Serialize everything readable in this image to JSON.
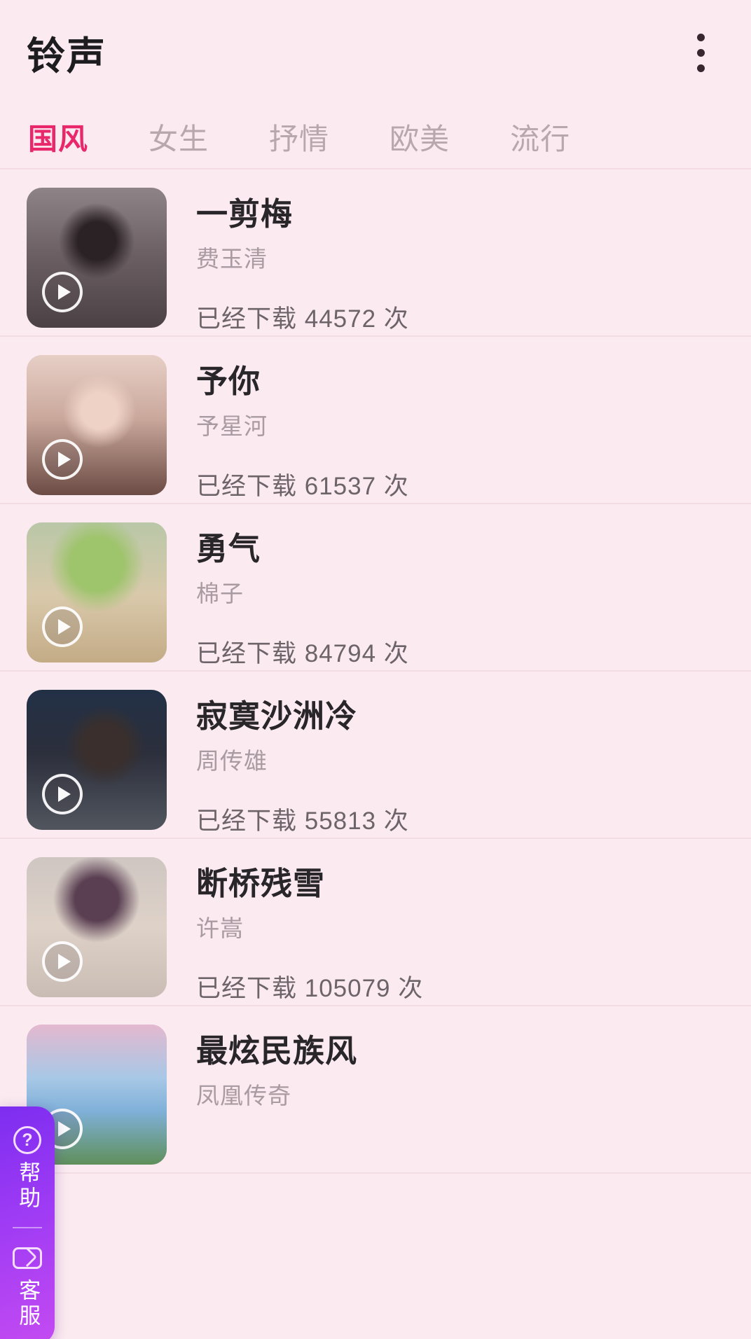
{
  "header": {
    "title": "铃声",
    "overflow_menu_name": "more-options"
  },
  "tabs": [
    {
      "label": "国风",
      "active": true
    },
    {
      "label": "女生",
      "active": false
    },
    {
      "label": "抒情",
      "active": false
    },
    {
      "label": "欧美",
      "active": false
    },
    {
      "label": "流行",
      "active": false
    }
  ],
  "colors": {
    "background": "#fbeaef",
    "accent": "#e8286b",
    "title_text": "#29262a",
    "artist_text": "#a89ba1",
    "downloads_text": "#6d6469",
    "widget_purple": "#9c3af4"
  },
  "ringtones": [
    {
      "title": "一剪梅",
      "artist": "费玉清",
      "downloads": "已经下载 44572 次",
      "download_count": 44572,
      "thumb": "portrait-woman-glasses"
    },
    {
      "title": "予你",
      "artist": "予星河",
      "downloads": "已经下载 61537 次",
      "download_count": 61537,
      "thumb": "portrait-woman-longhair"
    },
    {
      "title": "勇气",
      "artist": "棉子",
      "downloads": "已经下载 84794 次",
      "download_count": 84794,
      "thumb": "cat-in-green-hat"
    },
    {
      "title": "寂寞沙洲冷",
      "artist": "周传雄",
      "downloads": "已经下载 55813 次",
      "download_count": 55813,
      "thumb": "portrait-man-night-city"
    },
    {
      "title": "断桥残雪",
      "artist": "许嵩",
      "downloads": "已经下载 105079 次",
      "download_count": 105079,
      "thumb": "portrait-woman-braids"
    },
    {
      "title": "最炫民族风",
      "artist": "凤凰传奇",
      "downloads": "",
      "download_count": null,
      "thumb": "portrait-woman-seaside"
    }
  ],
  "side_widget": {
    "help_label": "帮助",
    "service_label": "客服"
  }
}
